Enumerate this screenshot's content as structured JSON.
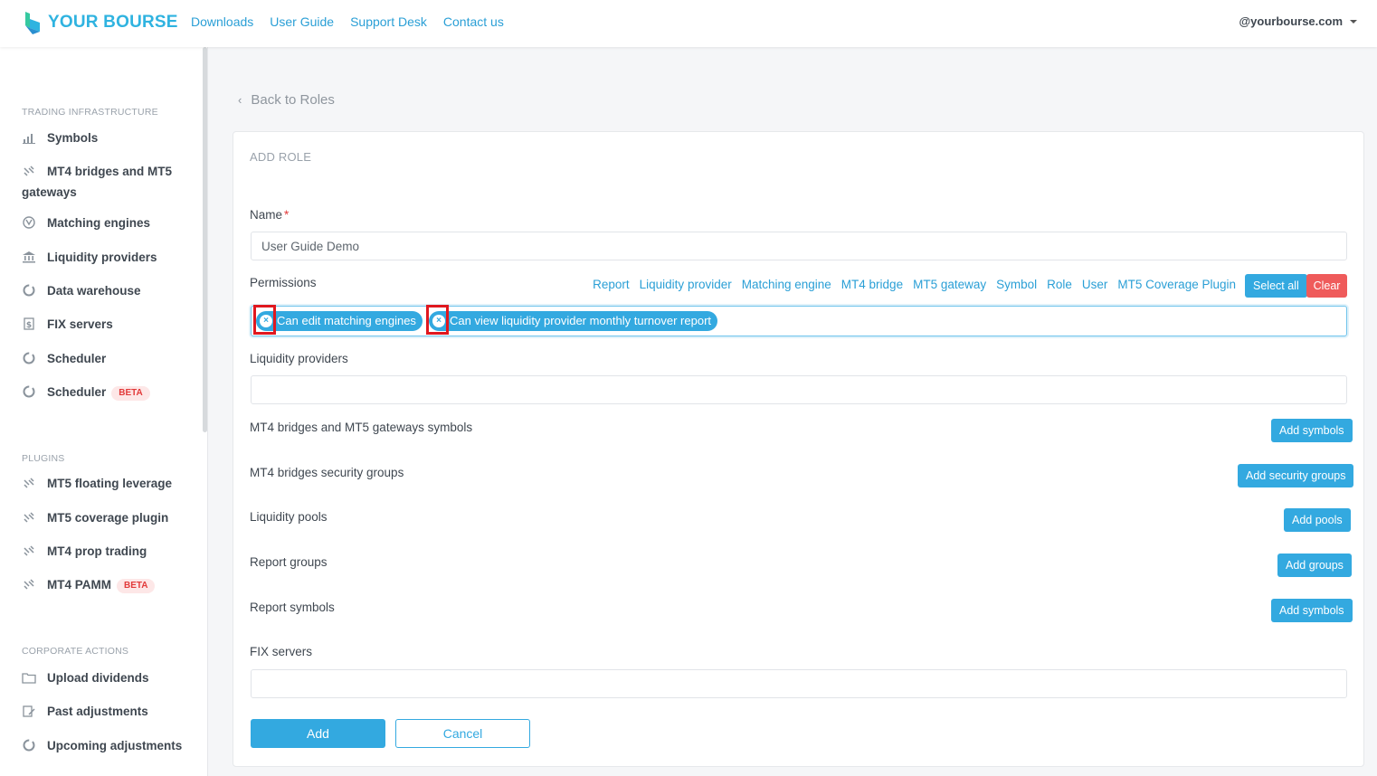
{
  "header": {
    "logo_text": "YOUR BOURSE",
    "nav": [
      "Downloads",
      "User Guide",
      "Support Desk",
      "Contact us"
    ],
    "user": "@yourbourse.com"
  },
  "sidebar": {
    "sections": [
      {
        "title": "TRADING INFRASTRUCTURE",
        "items": [
          {
            "label": "Symbols",
            "icon": "bar-chart-icon"
          },
          {
            "label": "MT4 bridges and MT5",
            "label2": "gateways",
            "icon": "link-icon"
          },
          {
            "label": "Matching engines",
            "icon": "engine-icon"
          },
          {
            "label": "Liquidity providers",
            "icon": "bank-icon"
          },
          {
            "label": "Data warehouse",
            "icon": "circle-icon"
          },
          {
            "label": "FIX servers",
            "icon": "dollar-doc-icon"
          },
          {
            "label": "Scheduler",
            "icon": "circle-icon"
          },
          {
            "label": "Scheduler",
            "icon": "circle-icon",
            "badge": "BETA"
          }
        ]
      },
      {
        "title": "PLUGINS",
        "items": [
          {
            "label": "MT5 floating leverage",
            "icon": "link-icon"
          },
          {
            "label": "MT5 coverage plugin",
            "icon": "link-icon"
          },
          {
            "label": "MT4 prop trading",
            "icon": "link-icon"
          },
          {
            "label": "MT4 PAMM",
            "icon": "link-icon",
            "badge": "BETA"
          }
        ]
      },
      {
        "title": "CORPORATE ACTIONS",
        "items": [
          {
            "label": "Upload dividends",
            "icon": "folder-icon"
          },
          {
            "label": "Past adjustments",
            "icon": "edit-icon"
          },
          {
            "label": "Upcoming adjustments",
            "icon": "circle-icon"
          }
        ]
      }
    ]
  },
  "main": {
    "back_label": "Back to Roles",
    "card_title": "ADD ROLE",
    "name_label": "Name",
    "name_required": "*",
    "name_value": "User Guide Demo",
    "permissions_label": "Permissions",
    "permission_filters": [
      "Report",
      "Liquidity provider",
      "Matching engine",
      "MT4 bridge",
      "MT5 gateway",
      "Symbol",
      "Role",
      "User",
      "MT5 Coverage Plugin"
    ],
    "select_all": "Select all",
    "clear": "Clear",
    "tags": [
      "Can edit matching engines",
      "Can view liquidity provider monthly turnover report"
    ],
    "tag_remove": "×",
    "liquidity_providers_label": "Liquidity providers",
    "mt4_symbols_label": "MT4 bridges and MT5 gateways symbols",
    "mt4_symbols_btn": "Add symbols",
    "security_groups_label": "MT4 bridges security groups",
    "security_groups_btn": "Add security groups",
    "liquidity_pools_label": "Liquidity pools",
    "liquidity_pools_btn": "Add pools",
    "report_groups_label": "Report groups",
    "report_groups_btn": "Add groups",
    "report_symbols_label": "Report symbols",
    "report_symbols_btn": "Add symbols",
    "fix_servers_label": "FIX servers",
    "add_btn": "Add",
    "cancel_btn": "Cancel"
  },
  "colors": {
    "accent": "#33a9e0",
    "danger": "#ef5b5b",
    "highlight": "#e0181f"
  }
}
